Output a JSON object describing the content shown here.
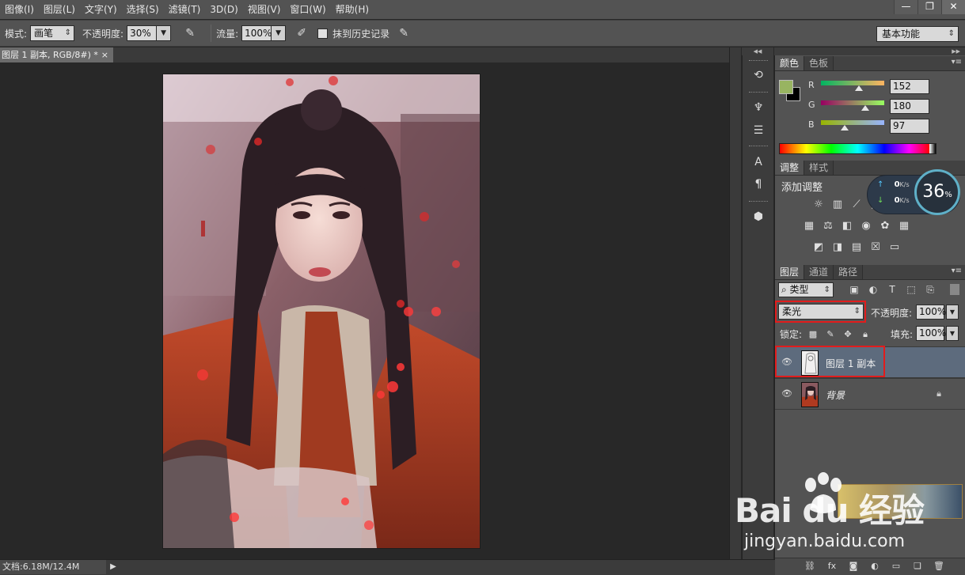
{
  "menu": {
    "items": [
      "图像(I)",
      "图层(L)",
      "文字(Y)",
      "选择(S)",
      "滤镜(T)",
      "3D(D)",
      "视图(V)",
      "窗口(W)",
      "帮助(H)"
    ]
  },
  "window_controls": {
    "minimize": "—",
    "restore": "❐",
    "close": "✕"
  },
  "options": {
    "mode_label": "模式:",
    "mode_value": "画笔",
    "opacity_label": "不透明度:",
    "opacity_value": "30%",
    "flow_label": "流量:",
    "flow_value": "100%",
    "erase_history_label": "抹到历史记录",
    "workspace": "基本功能"
  },
  "document": {
    "tab_title": "图层 1 副本, RGB/8#) *",
    "close": "×",
    "status": "文档:6.18M/12.4M"
  },
  "color_panel": {
    "tabs": [
      "颜色",
      "色板"
    ],
    "foreground": "#98b461",
    "background": "#000000",
    "channels": [
      {
        "label": "R",
        "value": "152",
        "fraction": 0.596
      },
      {
        "label": "G",
        "value": "180",
        "fraction": 0.706
      },
      {
        "label": "B",
        "value": "97",
        "fraction": 0.38
      }
    ]
  },
  "adjustments_panel": {
    "tabs": [
      "调整",
      "样式"
    ],
    "title": "添加调整"
  },
  "network_widget": {
    "upload": "0",
    "download": "0",
    "unit": "K/s",
    "percent": "36",
    "percent_sign": "%"
  },
  "layers_panel": {
    "tabs": [
      "图层",
      "通道",
      "路径"
    ],
    "filter_kind": "类型",
    "blend_mode": "柔光",
    "opacity_label": "不透明度:",
    "opacity_value": "100%",
    "lock_label": "锁定:",
    "fill_label": "填充:",
    "fill_value": "100%",
    "layers": [
      {
        "name": "图层 1 副本",
        "selected": true,
        "locked": false
      },
      {
        "name": "背景",
        "selected": false,
        "locked": true
      }
    ]
  },
  "watermark": {
    "logo": "Bai du 经验",
    "url": "jingyan.baidu.com"
  }
}
